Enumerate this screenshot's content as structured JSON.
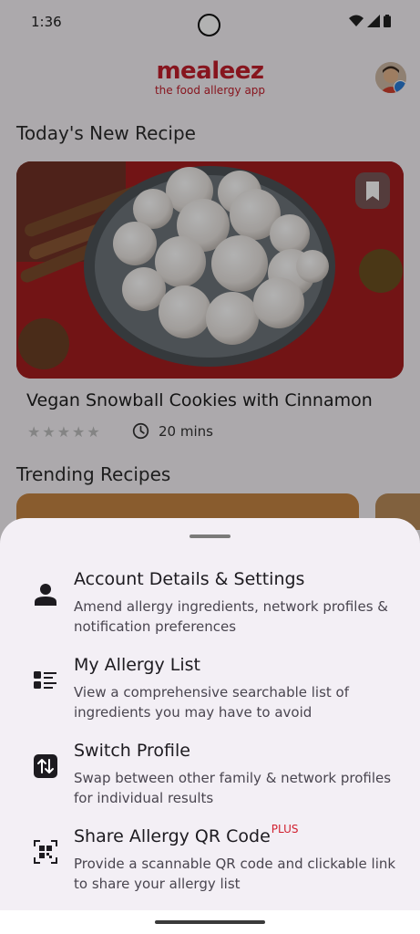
{
  "status_bar": {
    "time": "1:36",
    "icons": [
      "wifi-icon",
      "signal-icon",
      "battery-icon"
    ]
  },
  "header": {
    "brand": "mealeez",
    "tagline": "the food allergy app"
  },
  "todays_recipe": {
    "section_title": "Today's New Recipe",
    "recipe_title": "Vegan Snowball Cookies with Cinnamon",
    "rating": 0,
    "rating_max": 5,
    "duration": "20 mins"
  },
  "trending": {
    "section_title": "Trending Recipes"
  },
  "menu": {
    "items": [
      {
        "title": "Account Details & Settings",
        "description": "Amend allergy ingredients, network profiles & notification preferences",
        "icon": "person-icon"
      },
      {
        "title": "My Allergy List",
        "description": "View a comprehensive searchable list of ingredients you may have to avoid",
        "icon": "list-icon"
      },
      {
        "title": "Switch Profile",
        "description": "Swap between other family & network profiles for individual results",
        "icon": "swap-icon"
      },
      {
        "title": "Share Allergy QR Code",
        "badge": "PLUS",
        "description": "Provide a scannable QR code and clickable link to share your allergy list",
        "icon": "qr-code-icon"
      }
    ]
  },
  "colors": {
    "brand": "#c21f2c",
    "sheet_bg": "#f3eff5",
    "scrim": "rgba(0,0,0,0.30)"
  }
}
